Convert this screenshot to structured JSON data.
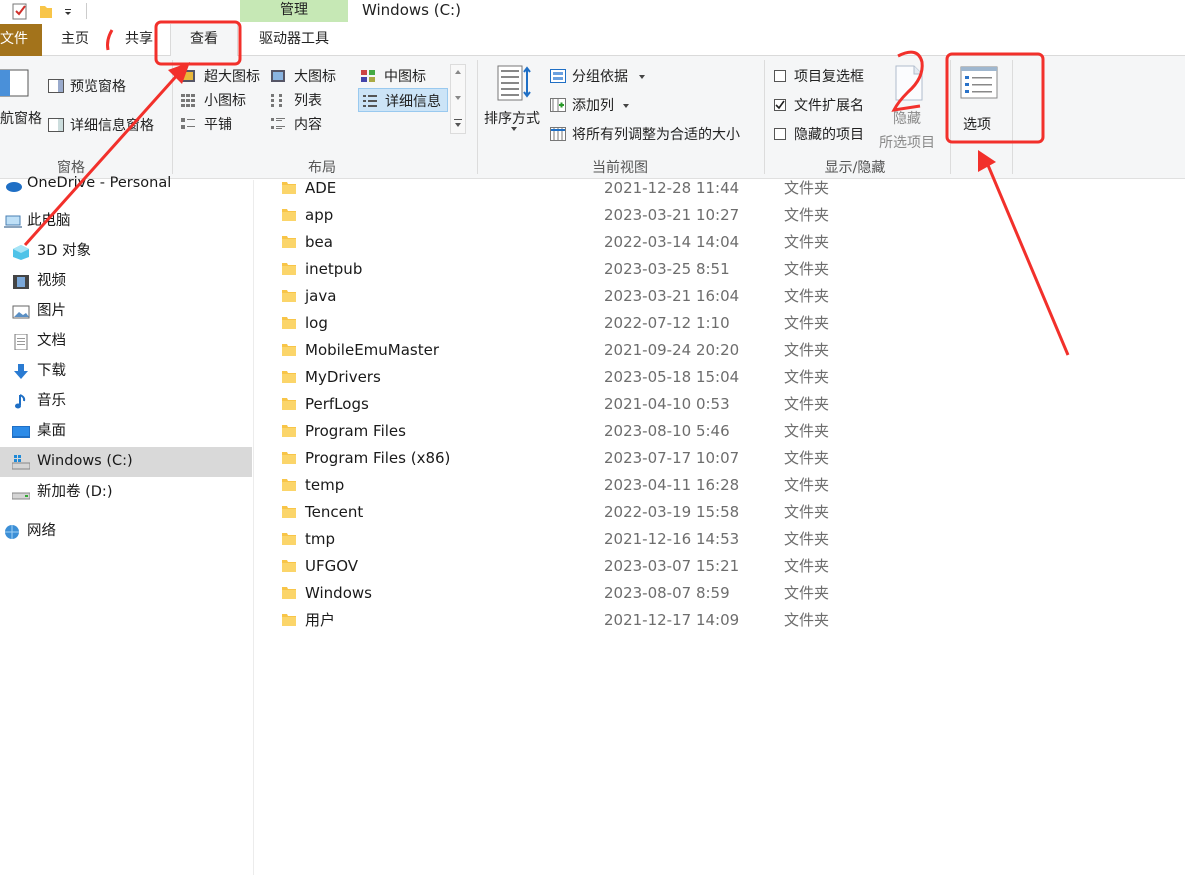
{
  "window": {
    "title": "Windows (C:)",
    "context_tab_header": "管理"
  },
  "tabs": {
    "file": "文件",
    "home": "主页",
    "share": "共享",
    "view": "查看",
    "drive_tools": "驱动器工具"
  },
  "ribbon": {
    "panes": {
      "nav_pane": "航窗格",
      "preview_pane": "预览窗格",
      "details_pane": "详细信息窗格",
      "label": "窗格"
    },
    "layout": {
      "extra_large": "超大图标",
      "large": "大图标",
      "medium": "中图标",
      "small": "小图标",
      "list": "列表",
      "details": "详细信息",
      "tiles": "平铺",
      "content": "内容",
      "label": "布局"
    },
    "current_view": {
      "sort_by": "排序方式",
      "group_by": "分组依据",
      "add_columns": "添加列",
      "size_columns": "将所有列调整为合适的大小",
      "label": "当前视图"
    },
    "show_hide": {
      "item_checkboxes": "项目复选框",
      "file_extensions": "文件扩展名",
      "hidden_items": "隐藏的项目",
      "hide_selected_1": "隐藏",
      "hide_selected_2": "所选项目",
      "label": "显示/隐藏"
    },
    "options": "选项"
  },
  "nav": {
    "onedrive": "OneDrive - Personal",
    "this_pc": "此电脑",
    "objects3d": "3D 对象",
    "videos": "视频",
    "pictures": "图片",
    "documents": "文档",
    "downloads": "下载",
    "music": "音乐",
    "desktop": "桌面",
    "drive_c": "Windows (C:)",
    "drive_d": "新加卷 (D:)",
    "network": "网络"
  },
  "files": [
    {
      "name": "ADE",
      "date": "2021-12-28 11:44",
      "type": "文件夹"
    },
    {
      "name": "app",
      "date": "2023-03-21 10:27",
      "type": "文件夹"
    },
    {
      "name": "bea",
      "date": "2022-03-14 14:04",
      "type": "文件夹"
    },
    {
      "name": "inetpub",
      "date": "2023-03-25 8:51",
      "type": "文件夹"
    },
    {
      "name": "java",
      "date": "2023-03-21 16:04",
      "type": "文件夹"
    },
    {
      "name": "log",
      "date": "2022-07-12 1:10",
      "type": "文件夹"
    },
    {
      "name": "MobileEmuMaster",
      "date": "2021-09-24 20:20",
      "type": "文件夹"
    },
    {
      "name": "MyDrivers",
      "date": "2023-05-18 15:04",
      "type": "文件夹"
    },
    {
      "name": "PerfLogs",
      "date": "2021-04-10 0:53",
      "type": "文件夹"
    },
    {
      "name": "Program Files",
      "date": "2023-08-10 5:46",
      "type": "文件夹"
    },
    {
      "name": "Program Files (x86)",
      "date": "2023-07-17 10:07",
      "type": "文件夹"
    },
    {
      "name": "temp",
      "date": "2023-04-11 16:28",
      "type": "文件夹"
    },
    {
      "name": "Tencent",
      "date": "2022-03-19 15:58",
      "type": "文件夹"
    },
    {
      "name": "tmp",
      "date": "2021-12-16 14:53",
      "type": "文件夹"
    },
    {
      "name": "UFGOV",
      "date": "2023-03-07 15:21",
      "type": "文件夹"
    },
    {
      "name": "Windows",
      "date": "2023-08-07 8:59",
      "type": "文件夹"
    },
    {
      "name": "用户",
      "date": "2021-12-17 14:09",
      "type": "文件夹"
    }
  ],
  "colors": {
    "annotation_red": "#f2302b",
    "file_tab": "#a3731b",
    "context_tab": "#c6e8b5",
    "selected_nav": "#d9d9d9",
    "folder_yellow": "#f8c548"
  }
}
